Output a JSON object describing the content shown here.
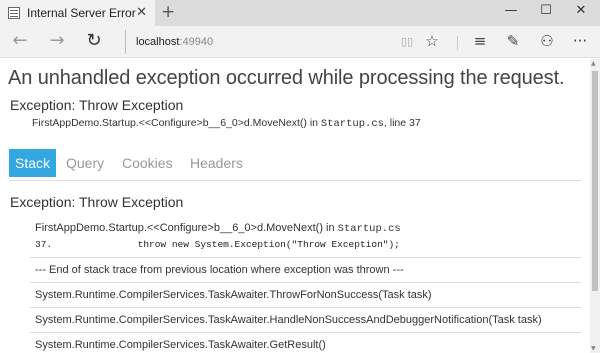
{
  "browser": {
    "tab_title": "Internal Server Error",
    "close_glyph": "✕",
    "new_tab_glyph": "+",
    "minimize_glyph": "—",
    "maximize_glyph": "☐",
    "window_close_glyph": "✕",
    "back_glyph": "←",
    "forward_glyph": "→",
    "refresh_glyph": "↻",
    "url_host": "localhost",
    "url_port": ":49940",
    "reading_view_glyph": "▯▯",
    "favorite_glyph": "☆",
    "hub_glyph": "≡",
    "note_glyph": "✎",
    "share_glyph": "⚇",
    "more_glyph": "···"
  },
  "page": {
    "heading": "An unhandled exception occurred while processing the request.",
    "exception_title": "Exception: Throw Exception",
    "location_method": "FirstAppDemo.Startup.<<Configure>b__6_0>d.MoveNext() in ",
    "location_file": "Startup.cs",
    "location_line": ", line 37",
    "tabs": [
      "Stack",
      "Query",
      "Cookies",
      "Headers"
    ],
    "stack_exception_title": "Exception: Throw Exception",
    "first_frame_method": "FirstAppDemo.Startup.<<Configure>b__6_0>d.MoveNext() in ",
    "first_frame_file": "Startup.cs",
    "first_frame_line_no": "37.",
    "first_frame_code": "throw new System.Exception(\"Throw Exception\");",
    "frames": [
      "--- End of stack trace from previous location where exception was thrown ---",
      "System.Runtime.CompilerServices.TaskAwaiter.ThrowForNonSuccess(Task task)",
      "System.Runtime.CompilerServices.TaskAwaiter.HandleNonSuccessAndDebuggerNotification(Task task)",
      "System.Runtime.CompilerServices.TaskAwaiter.GetResult()"
    ]
  },
  "colors": {
    "active_tab": "#33a8e0",
    "inactive_tab_text": "#999999"
  }
}
